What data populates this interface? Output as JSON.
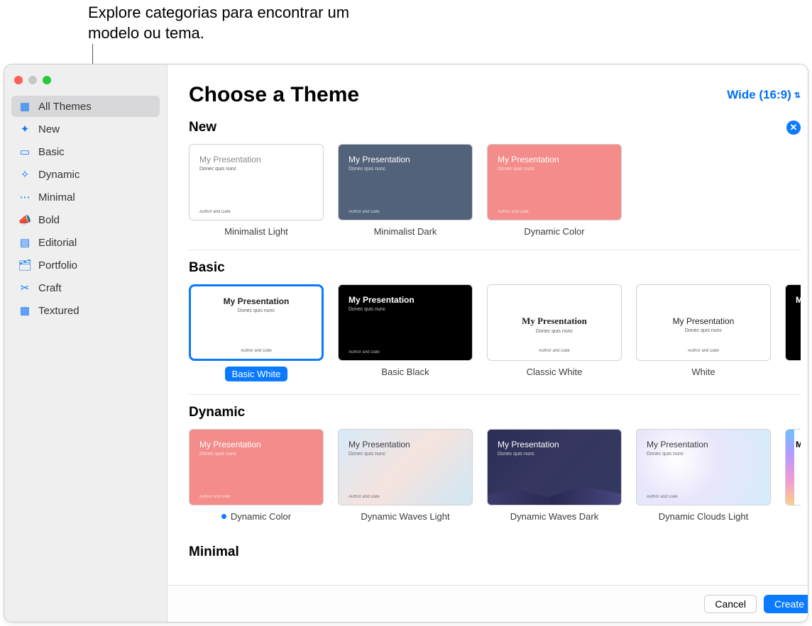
{
  "callout": "Explore categorias para encontrar um modelo ou tema.",
  "sidebar": {
    "items": [
      {
        "label": "All Themes",
        "icon": "▦"
      },
      {
        "label": "New",
        "icon": "✦"
      },
      {
        "label": "Basic",
        "icon": "▭"
      },
      {
        "label": "Dynamic",
        "icon": "✧"
      },
      {
        "label": "Minimal",
        "icon": "⋯"
      },
      {
        "label": "Bold",
        "icon": "📣"
      },
      {
        "label": "Editorial",
        "icon": "▤"
      },
      {
        "label": "Portfolio",
        "icon": "🗂"
      },
      {
        "label": "Craft",
        "icon": "✂"
      },
      {
        "label": "Textured",
        "icon": "▩"
      }
    ]
  },
  "header": {
    "title": "Choose a Theme",
    "ratio": "Wide (16:9)"
  },
  "preview": {
    "title": "My Presentation",
    "subtitle": "Donec quis nunc",
    "footer": "Author and Date"
  },
  "sections": {
    "new": {
      "title": "New",
      "themes": [
        "Minimalist Light",
        "Minimalist Dark",
        "Dynamic Color"
      ]
    },
    "basic": {
      "title": "Basic",
      "themes": [
        "Basic White",
        "Basic Black",
        "Classic White",
        "White"
      ]
    },
    "dynamic": {
      "title": "Dynamic",
      "themes": [
        "Dynamic Color",
        "Dynamic Waves Light",
        "Dynamic Waves Dark",
        "Dynamic Clouds Light"
      ]
    },
    "minimal": {
      "title": "Minimal"
    }
  },
  "buttons": {
    "cancel": "Cancel",
    "create": "Create"
  }
}
